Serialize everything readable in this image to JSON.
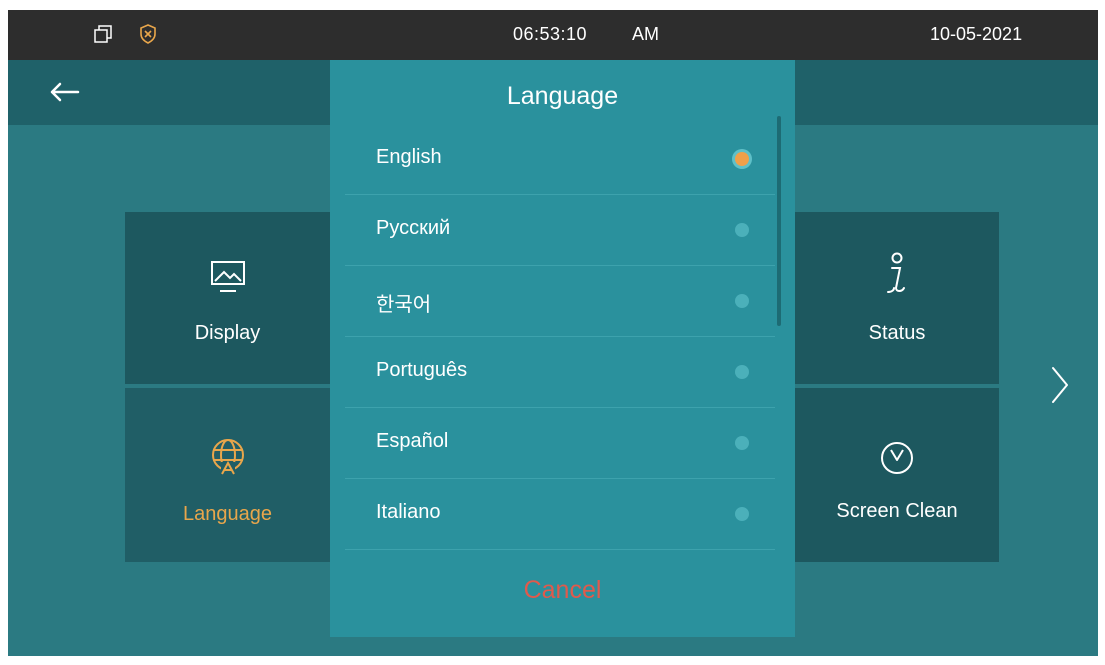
{
  "status_bar": {
    "time": "06:53:10",
    "ampm": "AM",
    "date": "10-05-2021",
    "icons": [
      "window-icon",
      "shield-icon"
    ]
  },
  "top_bar": {
    "back_icon": "arrow-left-icon"
  },
  "tiles": {
    "display": {
      "label": "Display",
      "icon": "picture-icon"
    },
    "language": {
      "label": "Language",
      "icon": "globe-icon"
    },
    "status": {
      "label": "Status",
      "icon": "info-icon"
    },
    "screen_clean": {
      "label": "Screen Clean",
      "icon": "timer-icon"
    }
  },
  "next_icon": "chevron-right-icon",
  "language_dialog": {
    "title": "Language",
    "languages": [
      {
        "label": "English",
        "selected": true
      },
      {
        "label": "Русский",
        "selected": false
      },
      {
        "label": "한국어",
        "selected": false
      },
      {
        "label": "Português",
        "selected": false
      },
      {
        "label": "Español",
        "selected": false
      },
      {
        "label": "Italiano",
        "selected": false
      }
    ],
    "cancel_label": "Cancel"
  },
  "colors": {
    "background": "#2b7a82",
    "status_bar": "#2d2d2d",
    "dialog": "#2a919d",
    "selected_radio": "#f0a04a",
    "active_label": "#e8a64b",
    "cancel": "#e05a4c"
  }
}
